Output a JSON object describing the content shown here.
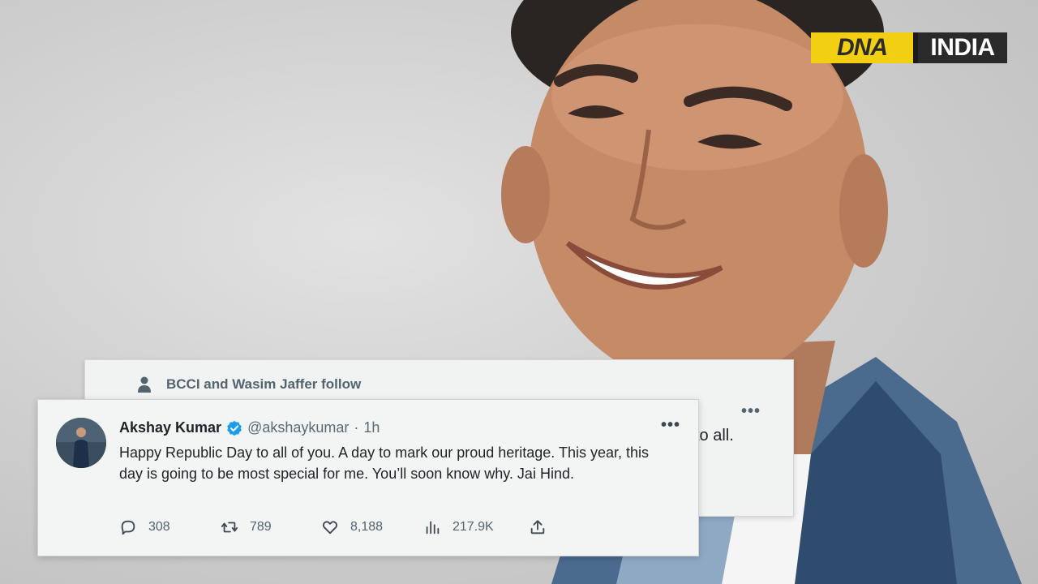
{
  "logo": {
    "dna": "DNA",
    "india": "INDIA",
    "colors": {
      "dna_bg": "#f3cf14",
      "india_bg": "#2a2a2a"
    }
  },
  "back_tweet": {
    "follow_text": "BCCI and Wasim Jaffer follow",
    "more_label": "•••",
    "snippet": "to all."
  },
  "tweet": {
    "display_name": "Akshay Kumar",
    "handle": "@akshaykumar",
    "separator": "·",
    "time": "1h",
    "more_label": "•••",
    "text": "Happy Republic Day to all of you. A day to mark our proud heritage. This year, this day is going to be most special for me. You’ll soon know why. Jai Hind.",
    "actions": {
      "replies": "308",
      "retweets": "789",
      "likes": "8,188",
      "views": "217.9K"
    },
    "icons": [
      "person-icon",
      "verified-badge-icon",
      "more-icon",
      "reply-icon",
      "retweet-icon",
      "like-icon",
      "views-icon",
      "share-icon"
    ],
    "accent": "#1d9bf0"
  }
}
